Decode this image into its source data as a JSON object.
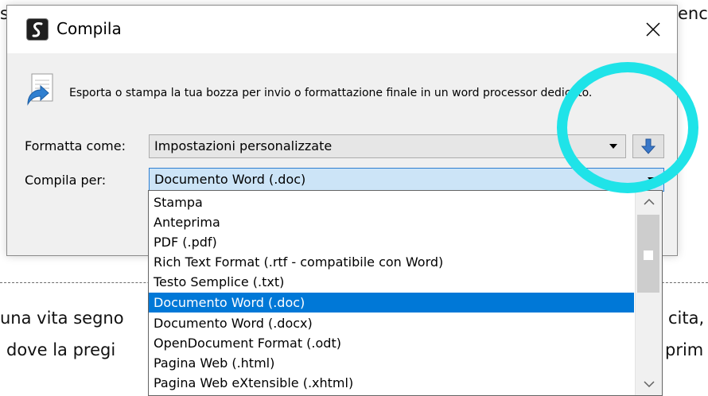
{
  "dialog": {
    "title": "Compila",
    "description": "Esporta o stampa la tua bozza per invio o formattazione finale in un word processor dedicato.",
    "format_label": "Formatta come:",
    "format_value": "Impostazioni personalizzate",
    "compile_label": "Compila per:",
    "compile_value": "Documento Word (.doc)",
    "options": [
      "Stampa",
      "Anteprima",
      "PDF (.pdf)",
      "Rich Text Format (.rtf - compatibile con Word)",
      "Testo Semplice (.txt)",
      "Documento Word (.doc)",
      "Documento Word (.docx)",
      "OpenDocument Format (.odt)",
      "Pagina Web (.html)",
      "Pagina Web eXtensible (.xhtml)"
    ],
    "selected_option": "Documento Word (.doc)"
  },
  "background": {
    "fragments": [
      "s:",
      "enc",
      "una vita segno",
      "cita,",
      "dove la pregi",
      "prim"
    ]
  },
  "colors": {
    "highlight": "#0078d7",
    "combo_focus": "#cce4f7",
    "annotation": "#1fe3e8",
    "down_arrow": "#3a78c9"
  },
  "icons": [
    "app-scrivener-icon",
    "close-icon",
    "export-document-icon",
    "down-arrow-icon",
    "chevron-down-icon",
    "scroll-up-icon",
    "scroll-down-icon"
  ]
}
